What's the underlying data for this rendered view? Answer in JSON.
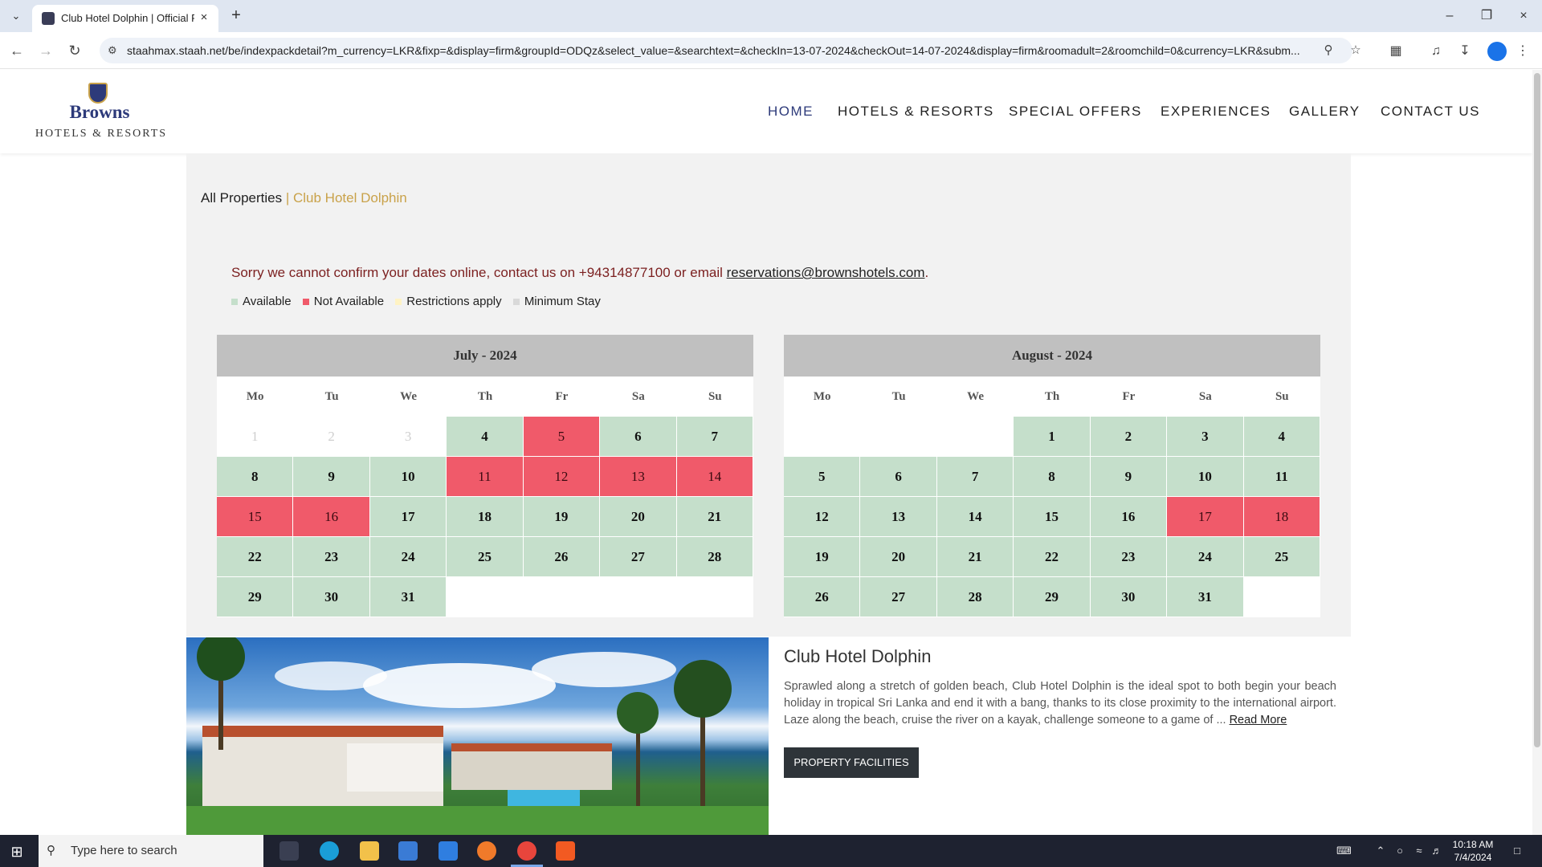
{
  "browser": {
    "tab_title": "Club Hotel Dolphin | Official Re",
    "url": "staahmax.staah.net/be/indexpackdetail?m_currency=LKR&fixp=&display=firm&groupId=ODQz&select_value=&searchtext=&checkIn=13-07-2024&checkOut=14-07-2024&display=firm&roomadult=2&roomchild=0&currency=LKR&subm..."
  },
  "site": {
    "logo_brand": "Browns",
    "logo_sub": "HOTELS & RESORTS",
    "nav": [
      "HOME",
      "HOTELS & RESORTS",
      "SPECIAL OFFERS",
      "EXPERIENCES",
      "GALLERY",
      "CONTACT US"
    ]
  },
  "breadcrumb": {
    "root": "All Properties",
    "separator": "|",
    "current": "Club Hotel Dolphin"
  },
  "notice": {
    "text": "Sorry we cannot confirm your dates online, contact us on +94314877100 or email",
    "email": "reservations@brownshotels.com",
    "end": "."
  },
  "legend": {
    "available": "Available",
    "not_available": "Not Available",
    "restrictions": "Restrictions apply",
    "min_stay": "Minimum Stay"
  },
  "colors": {
    "available": "#c5dfcb",
    "not_available": "#f05a6a",
    "restrictions": "#fff3c4",
    "min_stay": "#d9d9d9",
    "brand": "#2d3a7a",
    "accent": "#c9a24a"
  },
  "weekdays": [
    "Mo",
    "Tu",
    "We",
    "Th",
    "Fr",
    "Sa",
    "Su"
  ],
  "calendars": [
    {
      "title": "July - 2024",
      "days": [
        {
          "d": "1",
          "s": "past"
        },
        {
          "d": "2",
          "s": "past"
        },
        {
          "d": "3",
          "s": "past"
        },
        {
          "d": "4",
          "s": "available"
        },
        {
          "d": "5",
          "s": "unavailable"
        },
        {
          "d": "6",
          "s": "available"
        },
        {
          "d": "7",
          "s": "available"
        },
        {
          "d": "8",
          "s": "available"
        },
        {
          "d": "9",
          "s": "available"
        },
        {
          "d": "10",
          "s": "available"
        },
        {
          "d": "11",
          "s": "unavailable"
        },
        {
          "d": "12",
          "s": "unavailable"
        },
        {
          "d": "13",
          "s": "unavailable"
        },
        {
          "d": "14",
          "s": "unavailable"
        },
        {
          "d": "15",
          "s": "unavailable"
        },
        {
          "d": "16",
          "s": "unavailable"
        },
        {
          "d": "17",
          "s": "available"
        },
        {
          "d": "18",
          "s": "available"
        },
        {
          "d": "19",
          "s": "available"
        },
        {
          "d": "20",
          "s": "available"
        },
        {
          "d": "21",
          "s": "available"
        },
        {
          "d": "22",
          "s": "available"
        },
        {
          "d": "23",
          "s": "available"
        },
        {
          "d": "24",
          "s": "available"
        },
        {
          "d": "25",
          "s": "available"
        },
        {
          "d": "26",
          "s": "available"
        },
        {
          "d": "27",
          "s": "available"
        },
        {
          "d": "28",
          "s": "available"
        },
        {
          "d": "29",
          "s": "available"
        },
        {
          "d": "30",
          "s": "available"
        },
        {
          "d": "31",
          "s": "available"
        },
        {
          "d": "",
          "s": "empty"
        },
        {
          "d": "",
          "s": "empty"
        },
        {
          "d": "",
          "s": "empty"
        },
        {
          "d": "",
          "s": "empty"
        }
      ]
    },
    {
      "title": "August - 2024",
      "days": [
        {
          "d": "",
          "s": "empty"
        },
        {
          "d": "",
          "s": "empty"
        },
        {
          "d": "",
          "s": "empty"
        },
        {
          "d": "1",
          "s": "available"
        },
        {
          "d": "2",
          "s": "available"
        },
        {
          "d": "3",
          "s": "available"
        },
        {
          "d": "4",
          "s": "available"
        },
        {
          "d": "5",
          "s": "available"
        },
        {
          "d": "6",
          "s": "available"
        },
        {
          "d": "7",
          "s": "available"
        },
        {
          "d": "8",
          "s": "available"
        },
        {
          "d": "9",
          "s": "available"
        },
        {
          "d": "10",
          "s": "available"
        },
        {
          "d": "11",
          "s": "available"
        },
        {
          "d": "12",
          "s": "available"
        },
        {
          "d": "13",
          "s": "available"
        },
        {
          "d": "14",
          "s": "available"
        },
        {
          "d": "15",
          "s": "available"
        },
        {
          "d": "16",
          "s": "available"
        },
        {
          "d": "17",
          "s": "unavailable"
        },
        {
          "d": "18",
          "s": "unavailable"
        },
        {
          "d": "19",
          "s": "available"
        },
        {
          "d": "20",
          "s": "available"
        },
        {
          "d": "21",
          "s": "available"
        },
        {
          "d": "22",
          "s": "available"
        },
        {
          "d": "23",
          "s": "available"
        },
        {
          "d": "24",
          "s": "available"
        },
        {
          "d": "25",
          "s": "available"
        },
        {
          "d": "26",
          "s": "available"
        },
        {
          "d": "27",
          "s": "available"
        },
        {
          "d": "28",
          "s": "available"
        },
        {
          "d": "29",
          "s": "available"
        },
        {
          "d": "30",
          "s": "available"
        },
        {
          "d": "31",
          "s": "available"
        },
        {
          "d": "",
          "s": "empty"
        }
      ]
    }
  ],
  "hotel": {
    "name": "Club Hotel Dolphin",
    "description": "Sprawled along a stretch of golden beach, Club Hotel Dolphin is the ideal spot to both begin your beach holiday in tropical Sri Lanka and end it with a bang, thanks to its close proximity to the international airport. Laze along the beach, cruise the river on a kayak, challenge someone to a game of ...",
    "read_more": "Read More",
    "facilities_button": "PROPERTY FACILITIES"
  },
  "taskbar": {
    "search_placeholder": "Type here to search",
    "time": "10:18 AM",
    "date": "7/4/2024"
  }
}
